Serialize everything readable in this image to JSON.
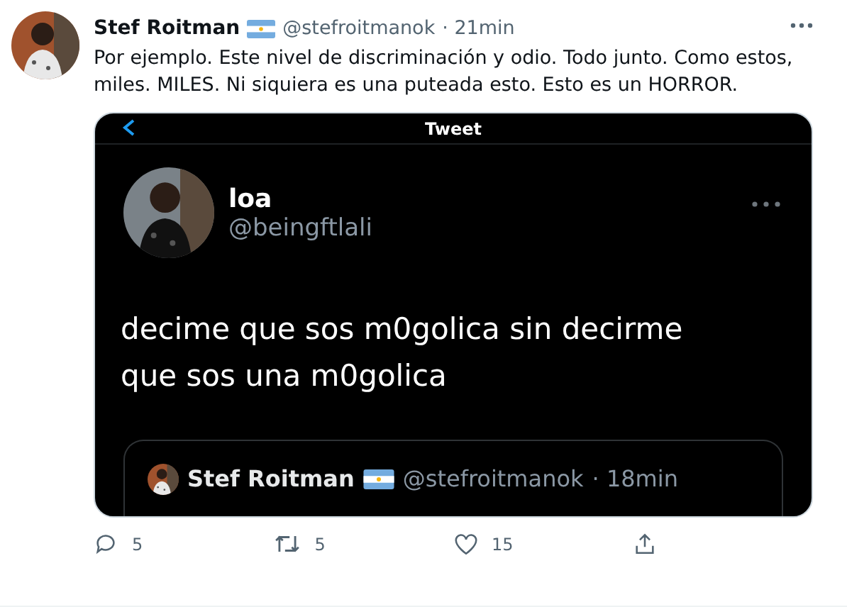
{
  "tweet": {
    "author": {
      "name": "Stef Roitman",
      "handle": "@stefroitmanok",
      "time": "· 21min"
    },
    "text": "Por ejemplo. Este nivel de discriminación y odio. Todo junto. Como estos, miles. MILES. Ni siquiera es una puteada esto. Esto es un HORROR.",
    "media": {
      "header_title": "Tweet",
      "inner_tweet": {
        "name": "loa",
        "handle": "@beingftlali",
        "text_lines": [
          "decime que sos m0golica sin decirme",
          "que sos una m0golica"
        ]
      },
      "quoted": {
        "name": "Stef Roitman",
        "handle": "@stefroitmanok",
        "time": "· 18min"
      }
    },
    "actions": [
      {
        "kind": "reply",
        "count": "5"
      },
      {
        "kind": "retweet",
        "count": "5"
      },
      {
        "kind": "like",
        "count": "15"
      },
      {
        "kind": "share"
      }
    ]
  }
}
